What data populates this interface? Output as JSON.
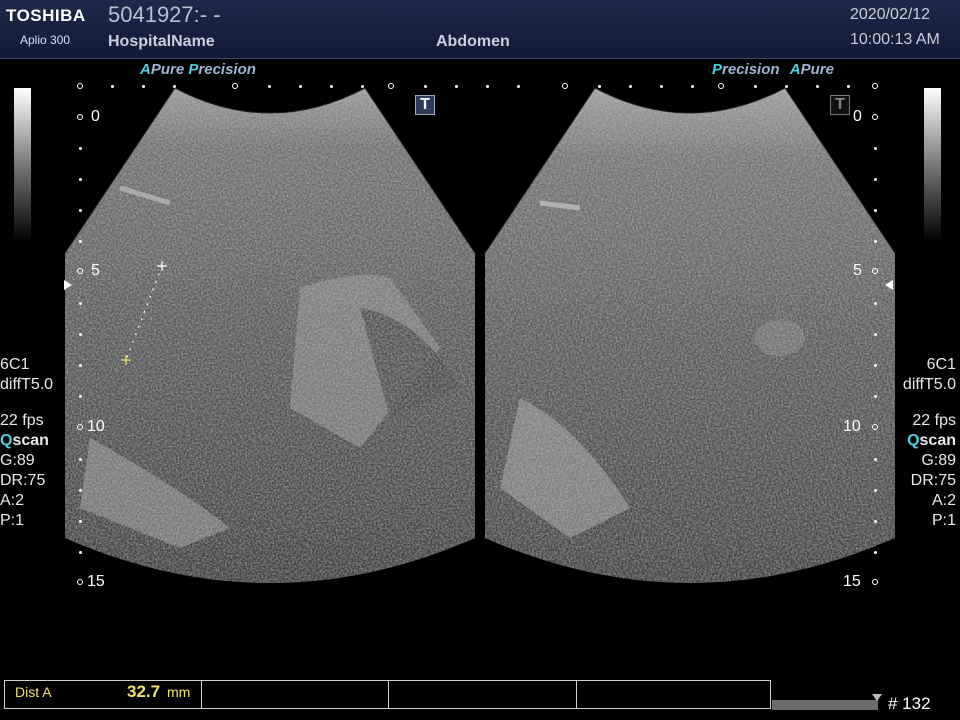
{
  "header": {
    "brand": "TOSHIBA",
    "model": "Aplio 300",
    "patient_id": "5041927:- -",
    "hospital": "HospitalName",
    "preset": "Abdomen",
    "date": "2020/02/12",
    "time": "10:00:13 AM"
  },
  "left_panel": {
    "label_a": "A",
    "label_pure": "Pure",
    "label_p": "P",
    "label_precision": "recision",
    "t_marker": "T"
  },
  "right_panel": {
    "label_p": "P",
    "label_precision": "recision",
    "label_a": "A",
    "label_pure": "Pure",
    "t_marker": "T"
  },
  "depth_scale": [
    "0",
    "5",
    "10",
    "15"
  ],
  "imaging_params": {
    "probe": "6C1",
    "mode": "diffT5.0",
    "fps": "22 fps",
    "qscan_q": "Q",
    "qscan_rest": "scan",
    "gain": "G:89",
    "dynamic_range": "DR:75",
    "a": "A:2",
    "p": "P:1"
  },
  "measurement": {
    "label": "Dist A",
    "value": "32.7",
    "unit": "mm"
  },
  "frame_number": "# 132",
  "colors": {
    "header_bg": "#1f2a4a",
    "accent_cyan": "#4ccfe0",
    "measurement_yellow": "#f1e46a"
  }
}
